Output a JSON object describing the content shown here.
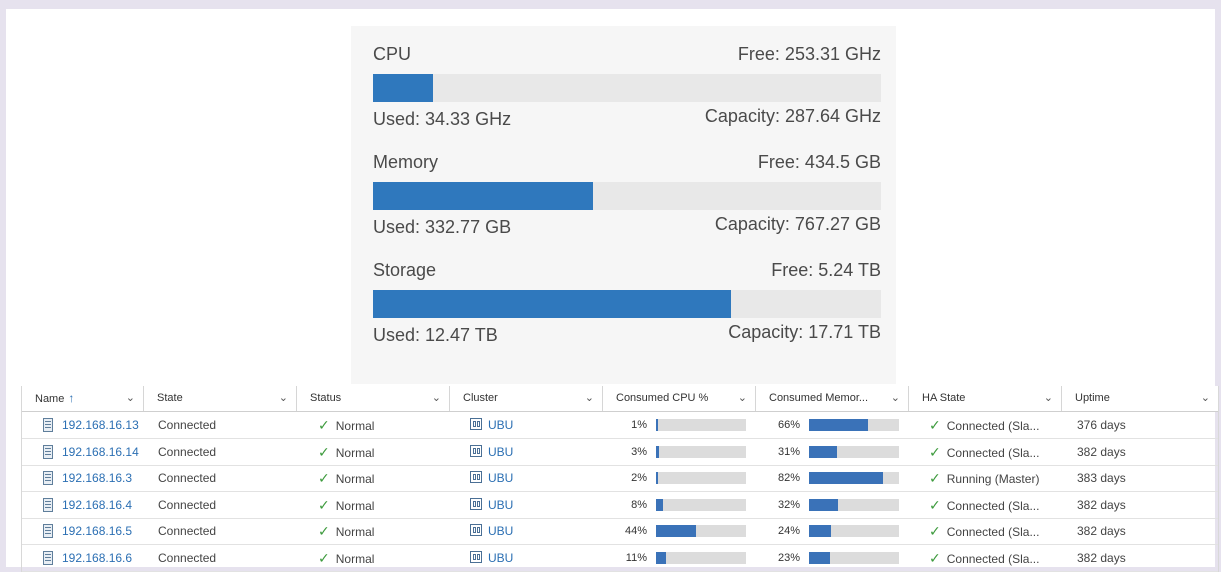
{
  "summary": {
    "resources": [
      {
        "name": "CPU",
        "free": "Free: 253.31 GHz",
        "used": "Used: 34.33 GHz",
        "capacity": "Capacity: 287.64 GHz",
        "used_fraction": 0.119
      },
      {
        "name": "Memory",
        "free": "Free: 434.5 GB",
        "used": "Used: 332.77 GB",
        "capacity": "Capacity: 767.27 GB",
        "used_fraction": 0.434
      },
      {
        "name": "Storage",
        "free": "Free: 5.24 TB",
        "used": "Used: 12.47 TB",
        "capacity": "Capacity: 17.71 TB",
        "used_fraction": 0.704
      }
    ]
  },
  "table": {
    "columns": [
      "Name",
      "State",
      "Status",
      "Cluster",
      "Consumed CPU %",
      "Consumed Memor...",
      "HA State",
      "Uptime"
    ],
    "sort_arrow": "↑",
    "chevron": "⌄",
    "rows": [
      {
        "name": "192.168.16.13",
        "state": "Connected",
        "status": "Normal",
        "cluster": "UBU",
        "cpu": "1%",
        "cpu_value": 1,
        "mem": "66%",
        "mem_value": 66,
        "ha": "Connected (Sla...",
        "uptime": "376 days"
      },
      {
        "name": "192.168.16.14",
        "state": "Connected",
        "status": "Normal",
        "cluster": "UBU",
        "cpu": "3%",
        "cpu_value": 3,
        "mem": "31%",
        "mem_value": 31,
        "ha": "Connected (Sla...",
        "uptime": "382 days"
      },
      {
        "name": "192.168.16.3",
        "state": "Connected",
        "status": "Normal",
        "cluster": "UBU",
        "cpu": "2%",
        "cpu_value": 2,
        "mem": "82%",
        "mem_value": 82,
        "ha": "Running (Master)",
        "uptime": "383 days"
      },
      {
        "name": "192.168.16.4",
        "state": "Connected",
        "status": "Normal",
        "cluster": "UBU",
        "cpu": "8%",
        "cpu_value": 8,
        "mem": "32%",
        "mem_value": 32,
        "ha": "Connected (Sla...",
        "uptime": "382 days"
      },
      {
        "name": "192.168.16.5",
        "state": "Connected",
        "status": "Normal",
        "cluster": "UBU",
        "cpu": "44%",
        "cpu_value": 44,
        "mem": "24%",
        "mem_value": 24,
        "ha": "Connected (Sla...",
        "uptime": "382 days"
      },
      {
        "name": "192.168.16.6",
        "state": "Connected",
        "status": "Normal",
        "cluster": "UBU",
        "cpu": "11%",
        "cpu_value": 11,
        "mem": "23%",
        "mem_value": 23,
        "ha": "Connected (Sla...",
        "uptime": "382 days"
      }
    ]
  },
  "icons": {
    "check": "✓",
    "host": "host-icon",
    "cluster": "cluster-icon"
  },
  "colors": {
    "bar_fill": "#2f78bd",
    "bar_track": "#e8e8e8",
    "link": "#2b6fb3",
    "ok": "#3c9a3c"
  }
}
